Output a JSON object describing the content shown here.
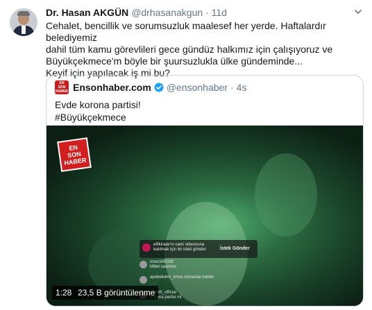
{
  "tweet": {
    "author_name": "Dr. Hasan AKGÜN",
    "handle": "@drhasanakgun",
    "separator": "·",
    "time": "11d",
    "lines": [
      "Cehalet, bencillik ve sorumsuzluk maalesef her yerde. Haftalardır belediyemiz",
      "dahil tüm kamu görevlileri gece gündüz halkımız için çalışıyoruz ve",
      "Büyükçekmece'm böyle bir şuursuzlukla ülke gündeminde...",
      "Keyif için yapılacak iş mi bu?"
    ],
    "menu_icon": "chevron-down-icon"
  },
  "quote": {
    "author_name": "Ensonhaber.com",
    "handle": "@ensonhaber",
    "separator": "·",
    "time": "4s",
    "lines": [
      "Evde korona partisi!",
      "#Büyükçekmece"
    ],
    "verified_icon": "verified-badge-icon",
    "video": {
      "logo_lines": [
        "EN",
        "SON",
        "HABER"
      ],
      "notification": {
        "text": "elifkiraav'ın canlı videosuna katılmak için bir istek gönder.",
        "button": "İstek Gönder"
      },
      "comments": [
        {
          "user": "omer345038",
          "text": "Millet saairmis"
        },
        {
          "user": "apobekdmr_emre.sismanlar katıldı",
          "text": ""
        },
        {
          "user": "anyerli_official",
          "text": "Corona partisi mi"
        }
      ],
      "duration": "1:28",
      "views": "23,5 B görüntülenme"
    }
  },
  "colors": {
    "text": "#14171a",
    "muted": "#657786",
    "border": "#ccd6dd",
    "verified": "#1da1f2",
    "logo_red": "#c81e1e"
  }
}
